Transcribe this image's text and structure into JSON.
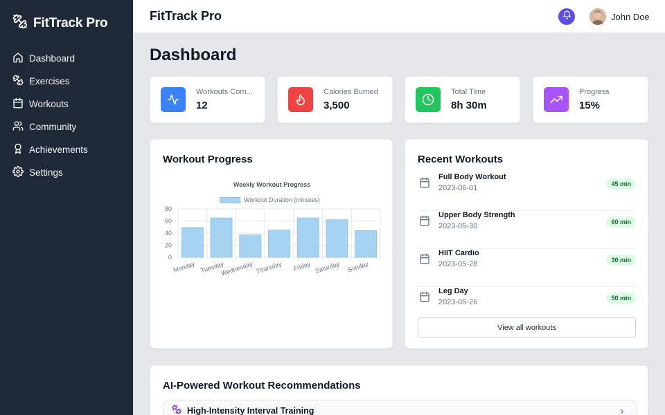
{
  "app": {
    "name": "FitTrack Pro"
  },
  "sidebar": {
    "items": [
      {
        "label": "Dashboard",
        "icon": "home-icon"
      },
      {
        "label": "Exercises",
        "icon": "dumbbell-icon"
      },
      {
        "label": "Workouts",
        "icon": "calendar-icon"
      },
      {
        "label": "Community",
        "icon": "users-icon"
      },
      {
        "label": "Achievements",
        "icon": "award-icon"
      },
      {
        "label": "Settings",
        "icon": "gear-icon"
      }
    ]
  },
  "header": {
    "title": "FitTrack Pro",
    "user_name": "John Doe"
  },
  "page": {
    "title": "Dashboard"
  },
  "stats": [
    {
      "label": "Workouts Com...",
      "value": "12",
      "icon": "activity-icon",
      "color": "#3b82f6"
    },
    {
      "label": "Calories Burned",
      "value": "3,500",
      "icon": "flame-icon",
      "color": "#ef4444"
    },
    {
      "label": "Total Time",
      "value": "8h 30m",
      "icon": "clock-icon",
      "color": "#22c55e"
    },
    {
      "label": "Progress",
      "value": "15%",
      "icon": "trending-up-icon",
      "color": "#a855f7"
    }
  ],
  "progress_card": {
    "title": "Workout Progress"
  },
  "chart_data": {
    "type": "bar",
    "title": "Weekly Workout Progress",
    "categories": [
      "Monday",
      "Tuesday",
      "Wednesday",
      "Thursday",
      "Friday",
      "Saturday",
      "Sunday"
    ],
    "series": [
      {
        "name": "Workout Duration (minutes)",
        "values": [
          49,
          65,
          37,
          45,
          65,
          62,
          44
        ]
      }
    ],
    "ylim": [
      0,
      80
    ],
    "yticks": [
      "80",
      "60",
      "40",
      "20",
      "0"
    ],
    "grid": true,
    "legend": "top",
    "colors": {
      "fill": "#a7d3f3",
      "stroke": "#8cc4ee"
    }
  },
  "recent": {
    "title": "Recent Workouts",
    "items": [
      {
        "name": "Full Body Workout",
        "date": "2023-06-01",
        "duration": "45 min"
      },
      {
        "name": "Upper Body Strength",
        "date": "2023-05-30",
        "duration": "60 min"
      },
      {
        "name": "HIIT Cardio",
        "date": "2023-05-28",
        "duration": "30 min"
      },
      {
        "name": "Leg Day",
        "date": "2023-05-26",
        "duration": "50 min"
      }
    ],
    "view_all": "View all workouts"
  },
  "recommendations": {
    "title": "AI-Powered Workout Recommendations",
    "items": [
      {
        "label": "High-Intensity Interval Training"
      }
    ]
  }
}
